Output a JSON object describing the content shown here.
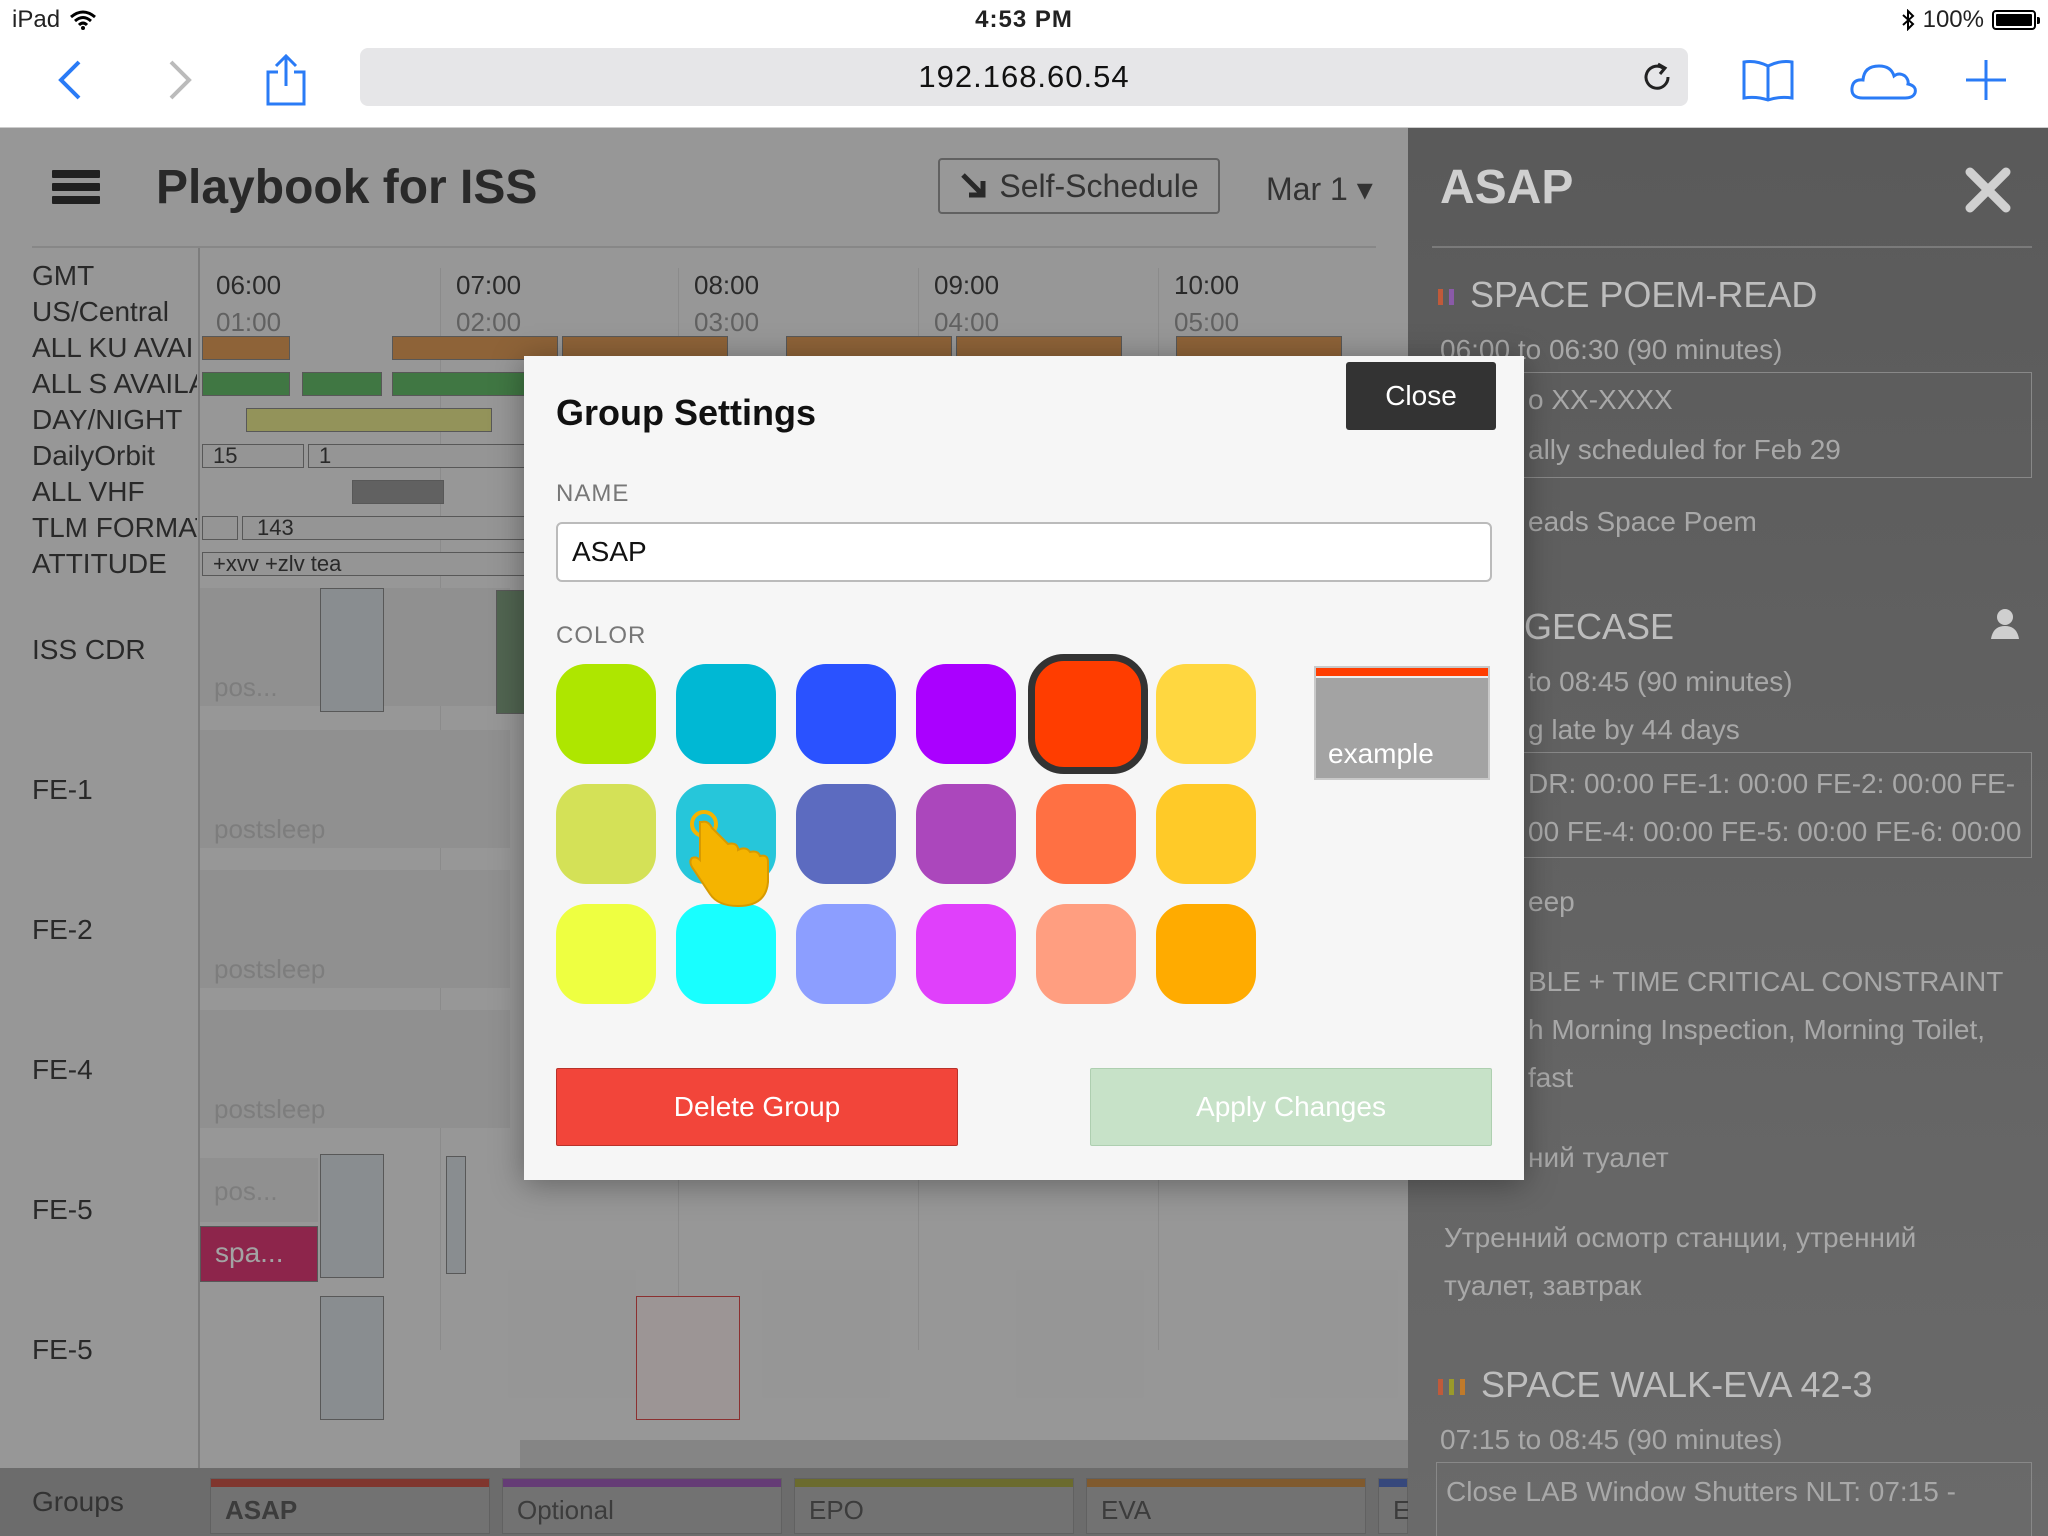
{
  "status_bar": {
    "device": "iPad",
    "time": "4:53 PM",
    "battery": "100%"
  },
  "browser": {
    "url": "192.168.60.54"
  },
  "app": {
    "title": "Playbook for ISS",
    "self_schedule_label": "Self-Schedule",
    "date_label": "Mar 1 ▾",
    "row_labels": [
      "GMT",
      "US/Central",
      "ALL KU AVAI",
      "ALL S AVAILA",
      "DAY/NIGHT",
      "DailyOrbit",
      "ALL VHF",
      "TLM FORMAT",
      "ATTITUDE",
      "ISS CDR",
      "FE-1",
      "FE-2",
      "FE-4",
      "FE-5",
      "FE-5"
    ],
    "hours": [
      {
        "gmt": "06:00",
        "local": "01:00"
      },
      {
        "gmt": "07:00",
        "local": "02:00"
      },
      {
        "gmt": "08:00",
        "local": "03:00"
      },
      {
        "gmt": "09:00",
        "local": "04:00"
      },
      {
        "gmt": "10:00",
        "local": "05:00"
      }
    ],
    "orbit_values": [
      "15",
      "1"
    ],
    "tlm_value": "143",
    "attitude_value": "+xvv +zlv tea",
    "lane_texts": {
      "cdr": "pos...",
      "fe1": "postsleep",
      "fe2": "postsleep",
      "fe4": "postsleep",
      "fe5_a": "pos...",
      "fe5_b": "spa..."
    },
    "groups_label": "Groups",
    "groups": [
      {
        "name": "ASAP",
        "color": "#c0392b"
      },
      {
        "name": "Optional",
        "color": "#8e44ad"
      },
      {
        "name": "EPO",
        "color": "#9a9a2a"
      },
      {
        "name": "EVA",
        "color": "#c07a2a"
      },
      {
        "name": "E",
        "color": "#3a5ab8"
      }
    ]
  },
  "right_panel": {
    "title": "ASAP",
    "item1_title": "SPACE POEM-READ",
    "item1_time": "06:00 to 06:30 (90 minutes)",
    "item1_box1": "o XX-XXXX",
    "item1_box2": "ally scheduled for Feb 29",
    "item1_desc": "eads Space Poem",
    "item2_title": "GECASE",
    "item2_time": "to 08:45 (90 minutes)",
    "item2_late": "g late by 44 days",
    "item2_box1": "DR: 00:00 FE-1: 00:00 FE-2: 00:00 FE-",
    "item2_box2": "00 FE-4: 00:00 FE-5: 00:00 FE-6: 00:00",
    "item2_sleep": "eep",
    "item2_constraint": "BLE + TIME CRITICAL CONSTRAINT",
    "item2_list1": "h Morning Inspection, Morning Toilet,",
    "item2_list2": "fast",
    "item2_ru1": "ний туалет",
    "item2_ru2": "Утренний осмотр станции, утренний",
    "item2_ru3": "туалет, завтрак",
    "item3_title": "SPACE WALK-EVA 42-3",
    "item3_time": "07:15 to 08:45 (90 minutes)",
    "item3_box1": "Close LAB Window Shutters NLT: 07:15 -"
  },
  "modal": {
    "title": "Group Settings",
    "close_label": "Close",
    "name_label": "NAME",
    "name_value": "ASAP",
    "color_label": "COLOR",
    "swatches": [
      [
        "#aee600",
        "#00b8d4",
        "#2a52ff",
        "#aa00ff",
        "#ff3d00",
        "#ffd740"
      ],
      [
        "#d4e157",
        "#26c6da",
        "#5c6bc0",
        "#ab47bc",
        "#ff7043",
        "#ffca28"
      ],
      [
        "#eeff41",
        "#18ffff",
        "#8c9eff",
        "#e040fb",
        "#ff9e80",
        "#ffab00"
      ]
    ],
    "selected_swatch": "#ff3d00",
    "example_label": "example",
    "delete_label": "Delete Group",
    "apply_label": "Apply Changes"
  }
}
